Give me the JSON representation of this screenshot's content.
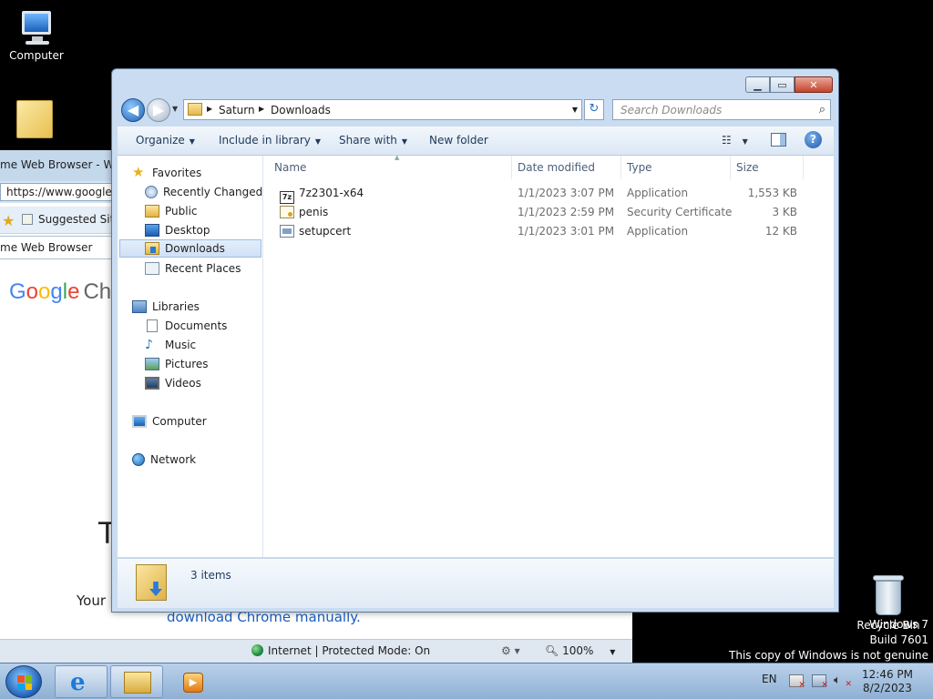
{
  "desktop": {
    "computer_label": "Computer",
    "recycle_label": "Recycle Bin"
  },
  "ie": {
    "title": "me Web Browser - Windo",
    "address": "https://www.google.c",
    "favorites_label": "Suggested Site",
    "tab_title": "me Web Browser",
    "logo": {
      "g": "G",
      "o1": "o",
      "o2": "o",
      "g2": "g",
      "l": "l",
      "e": "e",
      "chrome": "Chr"
    },
    "big_text": "T",
    "your_text": "Your",
    "manual_link": "download Chrome manually.",
    "status_zone": "Internet | Protected Mode: On",
    "zoom": "100%"
  },
  "explorer": {
    "breadcrumb": [
      "Saturn",
      "Downloads"
    ],
    "search_placeholder": "Search Downloads",
    "toolbar": {
      "organize": "Organize",
      "include_in_library": "Include in library",
      "share_with": "Share with",
      "new_folder": "New folder"
    },
    "nav": {
      "favorites": "Favorites",
      "favorites_items": [
        "Recently Changed",
        "Public",
        "Desktop",
        "Downloads",
        "Recent Places"
      ],
      "libraries": "Libraries",
      "libraries_items": [
        "Documents",
        "Music",
        "Pictures",
        "Videos"
      ],
      "computer": "Computer",
      "network": "Network"
    },
    "columns": {
      "name": "Name",
      "date": "Date modified",
      "type": "Type",
      "size": "Size"
    },
    "files": [
      {
        "name": "7z2301-x64",
        "date": "1/1/2023 3:07 PM",
        "type": "Application",
        "size": "1,553 KB"
      },
      {
        "name": "penis",
        "date": "1/1/2023 2:59 PM",
        "type": "Security Certificate",
        "size": "3 KB"
      },
      {
        "name": "setupcert",
        "date": "1/1/2023 3:01 PM",
        "type": "Application",
        "size": "12 KB"
      }
    ],
    "item_count": "3 items"
  },
  "taskbar": {
    "language": "EN",
    "time": "12:46 PM",
    "date": "8/2/2023"
  },
  "watermark": {
    "line1": "Windows 7",
    "line2": "Build 7601",
    "line3": "This copy of Windows is not genuine"
  }
}
